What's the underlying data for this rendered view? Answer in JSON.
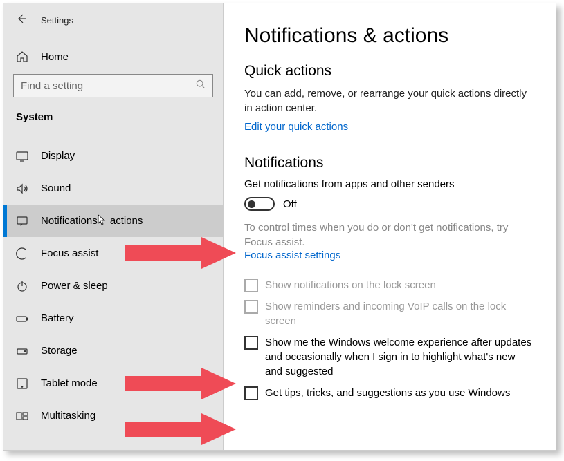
{
  "window_title": "Settings",
  "home_label": "Home",
  "search": {
    "placeholder": "Find a setting"
  },
  "category": "System",
  "nav": [
    {
      "label": "Display"
    },
    {
      "label": "Sound"
    },
    {
      "label": "Notifications & actions"
    },
    {
      "label": "Focus assist"
    },
    {
      "label": "Power & sleep"
    },
    {
      "label": "Battery"
    },
    {
      "label": "Storage"
    },
    {
      "label": "Tablet mode"
    },
    {
      "label": "Multitasking"
    }
  ],
  "page": {
    "title": "Notifications & actions",
    "quick_actions": {
      "heading": "Quick actions",
      "desc": "You can add, remove, or rearrange your quick actions directly in action center.",
      "link": "Edit your quick actions"
    },
    "notifications": {
      "heading": "Notifications",
      "get_label": "Get notifications from apps and other senders",
      "toggle_state": "Off",
      "hint": "To control times when you do or don't get notifications, try Focus assist.",
      "hint_link": "Focus assist settings",
      "checkboxes": [
        {
          "label": "Show notifications on the lock screen",
          "disabled": true
        },
        {
          "label": "Show reminders and incoming VoIP calls on the lock screen",
          "disabled": true
        },
        {
          "label": "Show me the Windows welcome experience after updates and occasionally when I sign in to highlight what's new and suggested",
          "disabled": false
        },
        {
          "label": "Get tips, tricks, and suggestions as you use Windows",
          "disabled": false
        }
      ]
    }
  }
}
